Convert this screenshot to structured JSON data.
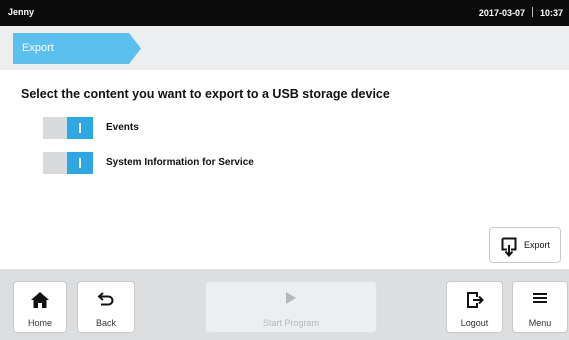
{
  "status_bar": {
    "user": "Jenny",
    "date": "2017-03-07",
    "time": "10:37"
  },
  "breadcrumb": {
    "label": "Export"
  },
  "main": {
    "prompt": "Select the content you want to export to a USB storage device",
    "options": [
      {
        "label": "Events",
        "enabled": true
      },
      {
        "label": "System Information for Service",
        "enabled": true
      }
    ],
    "export_button": {
      "label": "Export",
      "icon": "usb-export-icon"
    }
  },
  "bottom_nav": {
    "home": {
      "label": "Home",
      "icon": "home-icon"
    },
    "back": {
      "label": "Back",
      "icon": "back-arrow-icon"
    },
    "start_program": {
      "label": "Start Program",
      "icon": "play-icon",
      "disabled": true
    },
    "logout": {
      "label": "Logout",
      "icon": "logout-icon"
    },
    "menu": {
      "label": "Menu",
      "icon": "hamburger-menu-icon"
    }
  },
  "colors": {
    "accent": "#2ea8e2",
    "header": "#0b0b0b",
    "crumb": "#5bc0ee"
  }
}
